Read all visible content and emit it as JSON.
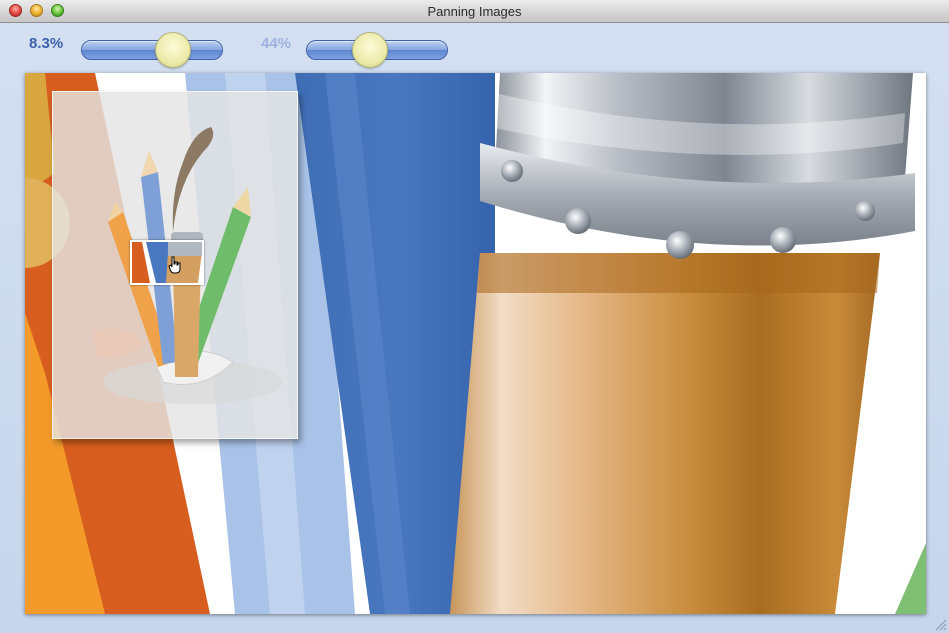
{
  "window": {
    "title": "Panning Images",
    "controls": [
      "close",
      "minimize",
      "maximize"
    ]
  },
  "toolbar": {
    "zoom_primary": {
      "label": "8.3%",
      "value_percent": 8.3,
      "color": "#3e5fb0"
    },
    "zoom_secondary": {
      "label": "44%",
      "value_percent": 44,
      "color": "#9db2de"
    }
  },
  "canvas": {
    "content": "zoomed artwork: paintbrush ferrule and colored pencils",
    "navigator": {
      "visible": true,
      "cursor": "hand-pointer-icon"
    }
  },
  "colors": {
    "window_bg": "#c9d8ee",
    "slider_track": "#6d93d8",
    "slider_knob": "#ecebaa",
    "navigator_frame": "#ffffff"
  }
}
